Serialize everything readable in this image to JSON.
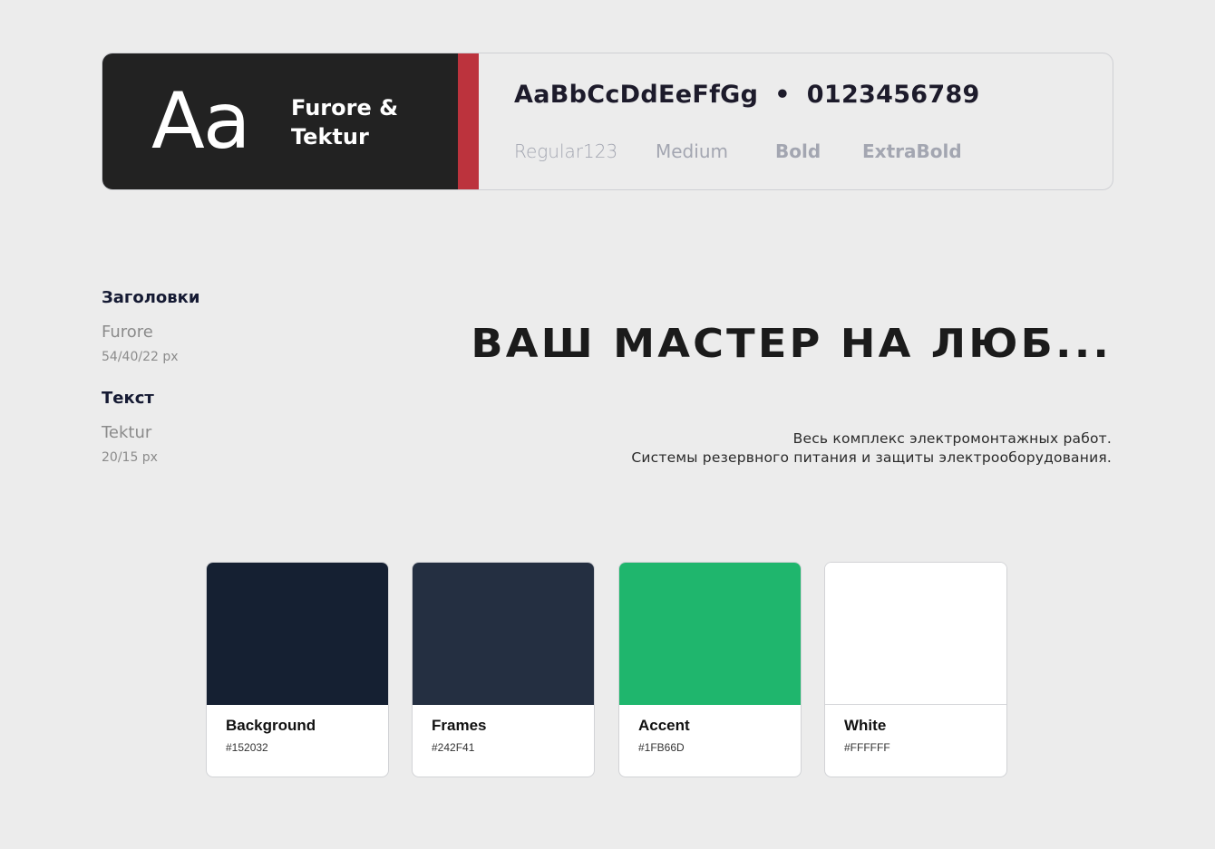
{
  "type_card": {
    "glyph": "Aa",
    "font_name_line1": "Furore &",
    "font_name_line2": "Tektur",
    "alphabet": "AaBbCcDdEeFfGg",
    "separator": "•",
    "digits": "0123456789",
    "weights": [
      "Regular123",
      "Medium",
      "Bold",
      "ExtraBold"
    ]
  },
  "info": {
    "headings_label": "Заголовки",
    "headings_font": "Furore",
    "headings_sizes": "54/40/22 px",
    "text_label": "Текст",
    "text_font": "Tektur",
    "text_sizes": "20/15 px"
  },
  "sample": {
    "headline": "ВАШ МАСТЕР НА ЛЮБ...",
    "body_line1": "Весь комплекс электромонтажных работ.",
    "body_line2": "Системы резервного питания и защиты электрооборудования."
  },
  "palette": [
    {
      "name": "Background",
      "hex": "#152032",
      "color": "#152032"
    },
    {
      "name": "Frames",
      "hex": "#242F41",
      "color": "#242F41"
    },
    {
      "name": "Accent",
      "hex": "#1FB66D",
      "color": "#1FB66D"
    },
    {
      "name": "White",
      "hex": "#FFFFFF",
      "color": "#FFFFFF"
    }
  ]
}
